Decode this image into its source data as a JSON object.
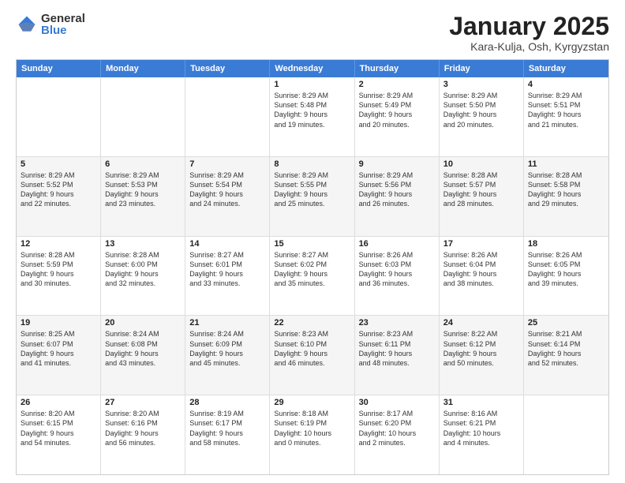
{
  "logo": {
    "general": "General",
    "blue": "Blue"
  },
  "title": "January 2025",
  "subtitle": "Kara-Kulja, Osh, Kyrgyzstan",
  "days_of_week": [
    "Sunday",
    "Monday",
    "Tuesday",
    "Wednesday",
    "Thursday",
    "Friday",
    "Saturday"
  ],
  "weeks": [
    {
      "alt": false,
      "cells": [
        {
          "day": "",
          "text": ""
        },
        {
          "day": "",
          "text": ""
        },
        {
          "day": "",
          "text": ""
        },
        {
          "day": "1",
          "text": "Sunrise: 8:29 AM\nSunset: 5:48 PM\nDaylight: 9 hours\nand 19 minutes."
        },
        {
          "day": "2",
          "text": "Sunrise: 8:29 AM\nSunset: 5:49 PM\nDaylight: 9 hours\nand 20 minutes."
        },
        {
          "day": "3",
          "text": "Sunrise: 8:29 AM\nSunset: 5:50 PM\nDaylight: 9 hours\nand 20 minutes."
        },
        {
          "day": "4",
          "text": "Sunrise: 8:29 AM\nSunset: 5:51 PM\nDaylight: 9 hours\nand 21 minutes."
        }
      ]
    },
    {
      "alt": true,
      "cells": [
        {
          "day": "5",
          "text": "Sunrise: 8:29 AM\nSunset: 5:52 PM\nDaylight: 9 hours\nand 22 minutes."
        },
        {
          "day": "6",
          "text": "Sunrise: 8:29 AM\nSunset: 5:53 PM\nDaylight: 9 hours\nand 23 minutes."
        },
        {
          "day": "7",
          "text": "Sunrise: 8:29 AM\nSunset: 5:54 PM\nDaylight: 9 hours\nand 24 minutes."
        },
        {
          "day": "8",
          "text": "Sunrise: 8:29 AM\nSunset: 5:55 PM\nDaylight: 9 hours\nand 25 minutes."
        },
        {
          "day": "9",
          "text": "Sunrise: 8:29 AM\nSunset: 5:56 PM\nDaylight: 9 hours\nand 26 minutes."
        },
        {
          "day": "10",
          "text": "Sunrise: 8:28 AM\nSunset: 5:57 PM\nDaylight: 9 hours\nand 28 minutes."
        },
        {
          "day": "11",
          "text": "Sunrise: 8:28 AM\nSunset: 5:58 PM\nDaylight: 9 hours\nand 29 minutes."
        }
      ]
    },
    {
      "alt": false,
      "cells": [
        {
          "day": "12",
          "text": "Sunrise: 8:28 AM\nSunset: 5:59 PM\nDaylight: 9 hours\nand 30 minutes."
        },
        {
          "day": "13",
          "text": "Sunrise: 8:28 AM\nSunset: 6:00 PM\nDaylight: 9 hours\nand 32 minutes."
        },
        {
          "day": "14",
          "text": "Sunrise: 8:27 AM\nSunset: 6:01 PM\nDaylight: 9 hours\nand 33 minutes."
        },
        {
          "day": "15",
          "text": "Sunrise: 8:27 AM\nSunset: 6:02 PM\nDaylight: 9 hours\nand 35 minutes."
        },
        {
          "day": "16",
          "text": "Sunrise: 8:26 AM\nSunset: 6:03 PM\nDaylight: 9 hours\nand 36 minutes."
        },
        {
          "day": "17",
          "text": "Sunrise: 8:26 AM\nSunset: 6:04 PM\nDaylight: 9 hours\nand 38 minutes."
        },
        {
          "day": "18",
          "text": "Sunrise: 8:26 AM\nSunset: 6:05 PM\nDaylight: 9 hours\nand 39 minutes."
        }
      ]
    },
    {
      "alt": true,
      "cells": [
        {
          "day": "19",
          "text": "Sunrise: 8:25 AM\nSunset: 6:07 PM\nDaylight: 9 hours\nand 41 minutes."
        },
        {
          "day": "20",
          "text": "Sunrise: 8:24 AM\nSunset: 6:08 PM\nDaylight: 9 hours\nand 43 minutes."
        },
        {
          "day": "21",
          "text": "Sunrise: 8:24 AM\nSunset: 6:09 PM\nDaylight: 9 hours\nand 45 minutes."
        },
        {
          "day": "22",
          "text": "Sunrise: 8:23 AM\nSunset: 6:10 PM\nDaylight: 9 hours\nand 46 minutes."
        },
        {
          "day": "23",
          "text": "Sunrise: 8:23 AM\nSunset: 6:11 PM\nDaylight: 9 hours\nand 48 minutes."
        },
        {
          "day": "24",
          "text": "Sunrise: 8:22 AM\nSunset: 6:12 PM\nDaylight: 9 hours\nand 50 minutes."
        },
        {
          "day": "25",
          "text": "Sunrise: 8:21 AM\nSunset: 6:14 PM\nDaylight: 9 hours\nand 52 minutes."
        }
      ]
    },
    {
      "alt": false,
      "cells": [
        {
          "day": "26",
          "text": "Sunrise: 8:20 AM\nSunset: 6:15 PM\nDaylight: 9 hours\nand 54 minutes."
        },
        {
          "day": "27",
          "text": "Sunrise: 8:20 AM\nSunset: 6:16 PM\nDaylight: 9 hours\nand 56 minutes."
        },
        {
          "day": "28",
          "text": "Sunrise: 8:19 AM\nSunset: 6:17 PM\nDaylight: 9 hours\nand 58 minutes."
        },
        {
          "day": "29",
          "text": "Sunrise: 8:18 AM\nSunset: 6:19 PM\nDaylight: 10 hours\nand 0 minutes."
        },
        {
          "day": "30",
          "text": "Sunrise: 8:17 AM\nSunset: 6:20 PM\nDaylight: 10 hours\nand 2 minutes."
        },
        {
          "day": "31",
          "text": "Sunrise: 8:16 AM\nSunset: 6:21 PM\nDaylight: 10 hours\nand 4 minutes."
        },
        {
          "day": "",
          "text": ""
        }
      ]
    }
  ]
}
